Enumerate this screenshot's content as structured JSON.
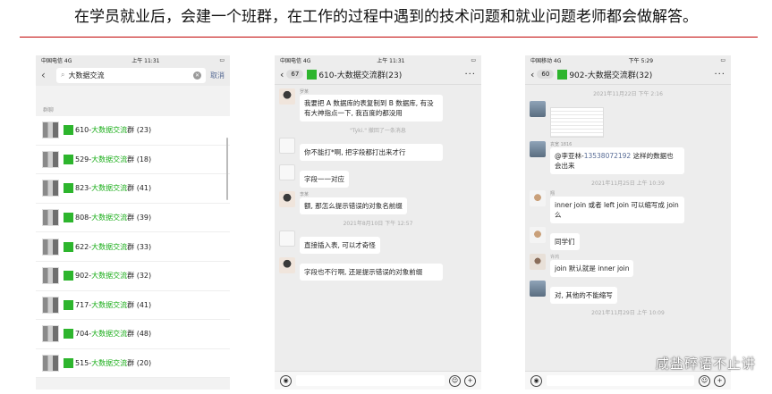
{
  "title": "在学员就业后，会建一个班群，在工作的过程中遇到的技术问题和就业问题老师都会做解答。",
  "phone1": {
    "status_left": "中国电信  4G",
    "status_time": "上午 11:31",
    "search_value": "大数据交流",
    "cancel": "取消",
    "section": "群聊",
    "groups": [
      {
        "prefix": "610-",
        "hl": "大数据交流",
        "suffix": "群 (23)"
      },
      {
        "prefix": "529-",
        "hl": "大数据交流",
        "suffix": "群 (18)"
      },
      {
        "prefix": "823-",
        "hl": "大数据交流",
        "suffix": "群 (41)"
      },
      {
        "prefix": "808-",
        "hl": "大数据交流",
        "suffix": "群 (39)"
      },
      {
        "prefix": "622-",
        "hl": "大数据交流",
        "suffix": "群 (33)"
      },
      {
        "prefix": "902-",
        "hl": "大数据交流",
        "suffix": "群 (32)"
      },
      {
        "prefix": "717-",
        "hl": "大数据交流",
        "suffix": "群 (41)"
      },
      {
        "prefix": "704-",
        "hl": "大数据交流",
        "suffix": "群 (48)"
      },
      {
        "prefix": "515-",
        "hl": "大数据交流",
        "suffix": "群 (20)"
      }
    ]
  },
  "phone2": {
    "status_left": "中国电信  4G",
    "status_time": "上午 11:31",
    "badge": "67",
    "title": "610-大数据交流群(23)",
    "msgs": [
      "我要把 A 数据库的表复制到 B 数据库, 有没有大神指点一下, 我百度的都没用",
      "你不能打*啊, 把字段都打出来才行",
      "字段一一对应",
      "额, 那怎么提示错误的对象名前缀",
      "直接插入表, 可以才奇怪",
      "字段也不行啊, 还是提示错误的对象前缀"
    ],
    "recall": "\"Tyki.\" 撤回了一条消息",
    "time1": "2021年8月10日 下午 12:57",
    "name1": "罗某",
    "name2": "李某"
  },
  "phone3": {
    "status_left": "中国移动  4G",
    "status_time": "下午 5:29",
    "badge": "60",
    "title": "902-大数据交流群(32)",
    "time1": "2021年11月22日 下午 2:16",
    "time2": "2021年11月25日 上午 10:39",
    "time3": "2021年11月29日 上午 10:09",
    "name_a": "袁宽 1816",
    "name_b": "翔",
    "name_c": "许鸿",
    "mention": "@李亚林-",
    "phone": "13538072192",
    "msg1_tail": " 这样的数据也会出来",
    "msg2": "inner join 或者 left join 可以缩写成 join 么",
    "msg3": "同学们",
    "msg4": "join 默认就是 inner join",
    "msg5": "对, 其他的不能缩写"
  },
  "watermark": "咸盐碎语不止讲",
  "colors": {
    "accent": "#c00000",
    "wechat_green": "#1aad19",
    "link": "#576b95"
  }
}
